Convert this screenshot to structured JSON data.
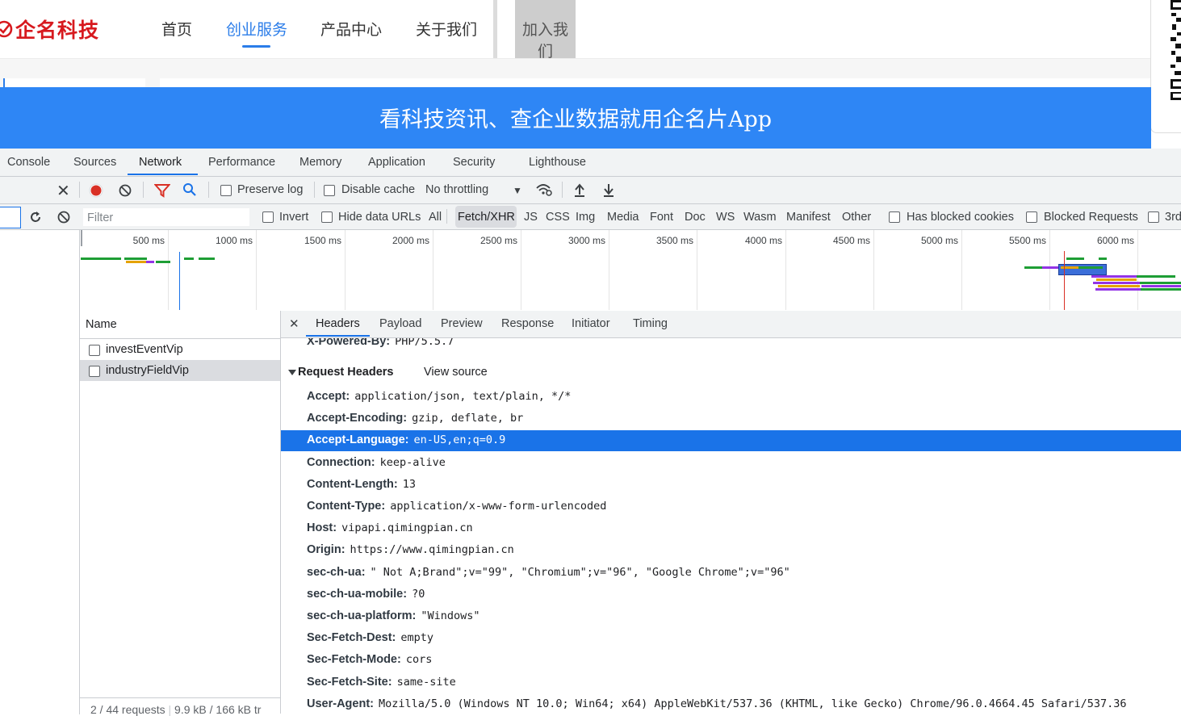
{
  "site": {
    "logo_text": "企名科技",
    "nav": [
      "首页",
      "创业服务",
      "产品中心",
      "关于我们",
      "加入我们"
    ],
    "active_nav": "创业服务",
    "banner": "看科技资讯、查企业数据就用企名片App",
    "brand_color": "#d7191e",
    "accent": "#2e86f5"
  },
  "devtools": {
    "tabs": [
      "Console",
      "Sources",
      "Network",
      "Performance",
      "Memory",
      "Application",
      "Security",
      "Lighthouse"
    ],
    "active_tab": "Network",
    "toolbar": {
      "record_icon": "record-icon",
      "preserve_log": "Preserve log",
      "disable_cache": "Disable cache",
      "throttling": "No throttling"
    },
    "filterbar": {
      "filter_placeholder": "Filter",
      "invert": "Invert",
      "hide_data_urls": "Hide data URLs",
      "types": [
        "All",
        "Fetch/XHR",
        "JS",
        "CSS",
        "Img",
        "Media",
        "Font",
        "Doc",
        "WS",
        "Wasm",
        "Manifest",
        "Other"
      ],
      "active_type": "Fetch/XHR",
      "has_blocked_cookies": "Has blocked cookies",
      "blocked_requests": "Blocked Requests",
      "third_party": "3rd"
    },
    "overview_ticks": [
      "500 ms",
      "1000 ms",
      "1500 ms",
      "2000 ms",
      "2500 ms",
      "3000 ms",
      "3500 ms",
      "4000 ms",
      "4500 ms",
      "5000 ms",
      "5500 ms",
      "6000 ms"
    ],
    "name_column": {
      "header": "Name",
      "requests": [
        "investEventVip",
        "industryFieldVip"
      ],
      "selected": "industryFieldVip",
      "status": "2 / 44 requests",
      "transfer": "9.9 kB / 166 kB tr"
    },
    "detail_tabs": [
      "Headers",
      "Payload",
      "Preview",
      "Response",
      "Initiator",
      "Timing"
    ],
    "active_detail_tab": "Headers",
    "partial_header": {
      "key": "X-Powered-By:",
      "value": "PHP/5.5.7"
    },
    "request_headers_title": "Request Headers",
    "view_source": "View source",
    "request_headers": [
      {
        "key": "Accept:",
        "value": "application/json, text/plain, */*"
      },
      {
        "key": "Accept-Encoding:",
        "value": "gzip, deflate, br"
      },
      {
        "key": "Accept-Language:",
        "value": "en-US,en;q=0.9"
      },
      {
        "key": "Connection:",
        "value": "keep-alive"
      },
      {
        "key": "Content-Length:",
        "value": "13"
      },
      {
        "key": "Content-Type:",
        "value": "application/x-www-form-urlencoded"
      },
      {
        "key": "Host:",
        "value": "vipapi.qimingpian.cn"
      },
      {
        "key": "Origin:",
        "value": "https://www.qimingpian.cn"
      },
      {
        "key": "sec-ch-ua:",
        "value": "\" Not A;Brand\";v=\"99\", \"Chromium\";v=\"96\", \"Google Chrome\";v=\"96\""
      },
      {
        "key": "sec-ch-ua-mobile:",
        "value": "?0"
      },
      {
        "key": "sec-ch-ua-platform:",
        "value": "\"Windows\""
      },
      {
        "key": "Sec-Fetch-Dest:",
        "value": "empty"
      },
      {
        "key": "Sec-Fetch-Mode:",
        "value": "cors"
      },
      {
        "key": "Sec-Fetch-Site:",
        "value": "same-site"
      },
      {
        "key": "User-Agent:",
        "value": "Mozilla/5.0 (Windows NT 10.0; Win64; x64) AppleWebKit/537.36 (KHTML, like Gecko) Chrome/96.0.4664.45 Safari/537.36"
      }
    ],
    "selected_header": "Accept-Language:",
    "selection_color": "#1a73e8"
  }
}
